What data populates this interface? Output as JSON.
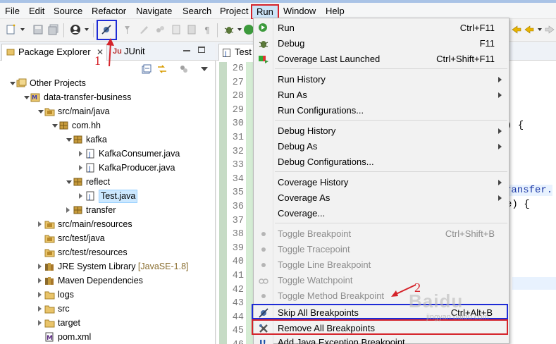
{
  "menubar": {
    "items": [
      "File",
      "Edit",
      "Source",
      "Refactor",
      "Navigate",
      "Search",
      "Project",
      "Run",
      "Window",
      "Help"
    ],
    "active": "Run"
  },
  "explorer": {
    "tabs": [
      {
        "label": "Package Explorer",
        "active": true
      },
      {
        "label": "JUnit",
        "active": false
      }
    ],
    "tree": [
      {
        "label": "Other Projects",
        "depth": 0,
        "state": "open",
        "icon": "working-set-icon"
      },
      {
        "label": "data-transfer-business",
        "depth": 1,
        "state": "open",
        "icon": "maven-project-icon"
      },
      {
        "label": "src/main/java",
        "depth": 2,
        "state": "open",
        "icon": "source-folder-icon"
      },
      {
        "label": "com.hh",
        "depth": 3,
        "state": "open",
        "icon": "package-icon"
      },
      {
        "label": "kafka",
        "depth": 4,
        "state": "open",
        "icon": "package-icon"
      },
      {
        "label": "KafkaConsumer.java",
        "depth": 5,
        "state": "closed",
        "icon": "java-file-icon"
      },
      {
        "label": "KafkaProducer.java",
        "depth": 5,
        "state": "closed",
        "icon": "java-file-icon"
      },
      {
        "label": "reflect",
        "depth": 4,
        "state": "open",
        "icon": "package-icon"
      },
      {
        "label": "Test.java",
        "depth": 5,
        "state": "closed",
        "icon": "java-file-icon",
        "selected": true
      },
      {
        "label": "transfer",
        "depth": 4,
        "state": "closed",
        "icon": "package-icon"
      },
      {
        "label": "src/main/resources",
        "depth": 2,
        "state": "closed",
        "icon": "source-folder-icon"
      },
      {
        "label": "src/test/java",
        "depth": 2,
        "state": "none",
        "icon": "source-folder-icon"
      },
      {
        "label": "src/test/resources",
        "depth": 2,
        "state": "none",
        "icon": "source-folder-icon"
      },
      {
        "label": "JRE System Library",
        "suffix": "[JavaSE-1.8]",
        "depth": 2,
        "state": "closed",
        "icon": "library-icon"
      },
      {
        "label": "Maven Dependencies",
        "depth": 2,
        "state": "closed",
        "icon": "library-icon"
      },
      {
        "label": "logs",
        "depth": 2,
        "state": "closed",
        "icon": "folder-icon"
      },
      {
        "label": "src",
        "depth": 2,
        "state": "closed",
        "icon": "folder-icon"
      },
      {
        "label": "target",
        "depth": 2,
        "state": "closed",
        "icon": "folder-icon"
      },
      {
        "label": "pom.xml",
        "depth": 2,
        "state": "none",
        "icon": "xml-file-icon"
      }
    ]
  },
  "editor": {
    "tab_label": "Test",
    "line_numbers": [
      "26",
      "27",
      "28",
      "29",
      "30",
      "31",
      "32",
      "33",
      "34",
      "35",
      "36",
      "37",
      "38",
      "39",
      "40",
      "41",
      "42",
      "43",
      "44",
      "45",
      "46"
    ],
    "visible_fragments": [
      ") {",
      "ransfer.",
      "e) {"
    ]
  },
  "run_menu": {
    "groups": [
      [
        {
          "label": "Run",
          "accel": "Ctrl+F11",
          "icon": "run-icon"
        },
        {
          "label": "Debug",
          "accel": "F11",
          "icon": "debug-icon"
        },
        {
          "label": "Coverage Last Launched",
          "accel": "Ctrl+Shift+F11",
          "icon": "coverage-icon"
        }
      ],
      [
        {
          "label": "Run History",
          "submenu": true
        },
        {
          "label": "Run As",
          "submenu": true
        },
        {
          "label": "Run Configurations..."
        }
      ],
      [
        {
          "label": "Debug History",
          "submenu": true
        },
        {
          "label": "Debug As",
          "submenu": true
        },
        {
          "label": "Debug Configurations..."
        }
      ],
      [
        {
          "label": "Coverage History",
          "submenu": true
        },
        {
          "label": "Coverage As",
          "submenu": true
        },
        {
          "label": "Coverage..."
        }
      ],
      [
        {
          "label": "Toggle Breakpoint",
          "accel": "Ctrl+Shift+B",
          "disabled": true,
          "icon": "dot-icon"
        },
        {
          "label": "Toggle Tracepoint",
          "disabled": true,
          "icon": "dot-icon"
        },
        {
          "label": "Toggle Line Breakpoint",
          "disabled": true,
          "icon": "dot-icon"
        },
        {
          "label": "Toggle Watchpoint",
          "disabled": true,
          "icon": "watchpoint-icon"
        },
        {
          "label": "Toggle Method Breakpoint",
          "disabled": true,
          "icon": "dot-icon"
        },
        {
          "label": "Skip All Breakpoints",
          "accel": "Ctrl+Alt+B",
          "icon": "skip-breakpoints-icon",
          "box": "blue"
        },
        {
          "label": "Remove All Breakpoints",
          "icon": "remove-breakpoints-icon",
          "box": "red"
        },
        {
          "label": "Add Java Exception Breakpoint...",
          "icon": "exception-breakpoint-icon"
        }
      ]
    ]
  },
  "annotations": {
    "marker_1": "1",
    "marker_2": "2",
    "watermark": "Baidu",
    "watermark_url": "jingyan.baidu.com"
  },
  "colors": {
    "annotation_red": "#d5232a",
    "annotation_blue": "#1e2bd6",
    "selection": "#cce8ff",
    "menu_bg": "#f2f2f2"
  }
}
